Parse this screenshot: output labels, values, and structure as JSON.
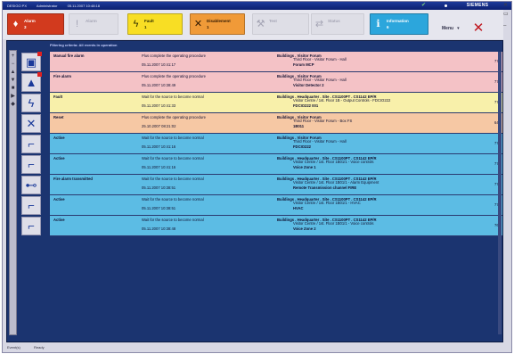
{
  "titlebar": {
    "app_name": "DESIGO PX",
    "user": "Administrator",
    "datetime": "05.11.2007 10:48:18",
    "brand": "SIEMENS",
    "check_icon": "check-icon",
    "dot_icon": "dot-icon"
  },
  "summary": {
    "buttons": [
      {
        "label": "Alarm",
        "count": "3",
        "icon": "alarm-bell-icon",
        "color": "#d23a1e"
      },
      {
        "label": "Alarm",
        "count": "",
        "icon": "alarm-grey-icon",
        "color": "#dedee6"
      },
      {
        "label": "Fault",
        "count": "1",
        "icon": "fault-lightning-icon",
        "color": "#f8de24"
      },
      {
        "label": "Disablement",
        "count": "1",
        "icon": "disablement-cross-icon",
        "color": "#f09a38"
      },
      {
        "label": "Test",
        "count": "",
        "icon": "test-icon",
        "color": "#dedee6"
      },
      {
        "label": "Status",
        "count": "",
        "icon": "status-icon",
        "color": "#dedee6"
      },
      {
        "label": "Information",
        "count": "6",
        "icon": "information-icon",
        "color": "#2ca6dc"
      }
    ],
    "menu_label": "Menu",
    "menu_chevron": "▾",
    "mute_icon": "✕"
  },
  "filter_text": "Filtering criteria: All events in operation",
  "left_tools": [
    "+",
    "−",
    "▲",
    "▼",
    "■",
    "▶",
    "◆"
  ],
  "rows": [
    {
      "color": "pink",
      "icon": "▣",
      "event": "Manual fire alarm",
      "hint": "Plus complete the operating procedure",
      "datetime": "05.11.2007  10:41:17",
      "location1": "Buildings . Visitor Forum",
      "location2": "Third Floor - Visitor Forum - Hall",
      "location3": "Forum MCP",
      "number": "776"
    },
    {
      "color": "pink",
      "icon": "▲",
      "event": "Fire alarm",
      "hint": "Plus complete the operating procedure",
      "datetime": "05.11.2007  10:38:49",
      "location1": "Buildings . Visitor Forum",
      "location2": "Third Floor - Visitor Forum - Hall",
      "location3": "Visitor Detector 2",
      "number": "772"
    },
    {
      "color": "yellow",
      "icon": "ϟ",
      "event": "Fault",
      "hint": "Wait for the source to become normal",
      "datetime": "05.11.2007  10:41:33",
      "location1": "Buildings . Headquarter . Site . CS1100PT . CS1142 EP/R",
      "location2": "Visitor Centre / 1st. Floor 1B - Output Controls - FDCIO222",
      "location3": "FDCIO222 001",
      "number": "774"
    },
    {
      "color": "peach",
      "icon": "✕",
      "event": "Reset",
      "hint": "Plus complete the operating procedure",
      "datetime": "25.10.2007  08:21:02",
      "location1": "Buildings . Visitor Forum",
      "location2": "Third Floor - Visitor Forum - Box FS",
      "location3": "1B011",
      "number": "649"
    },
    {
      "color": "cyan",
      "icon": "⌐",
      "event": "Active",
      "hint": "Wait for the source to become normal",
      "datetime": "05.11.2007  10:41:16",
      "location1": "Buildings . Visitor Forum",
      "location2": "Third Floor - Visitor Forum - Hall",
      "location3": "FDCIO222",
      "number": "777"
    },
    {
      "color": "cyan",
      "icon": "⌐",
      "event": "Active",
      "hint": "Wait for the source to become normal",
      "datetime": "05.11.2007  10:41:16",
      "location1": "Buildings . Headquarter . Site . CS1100PT . CS1142 EP/R",
      "location2": "Visitor Centre / 1st. Floor 1B01/1 - Voice controls",
      "location3": "Voice Zone 1",
      "number": "778"
    },
    {
      "color": "cyan",
      "icon": "⊷",
      "event": "Fire alarm transmitted",
      "hint": "Wait for the source to become normal",
      "datetime": "05.11.2007  10:38:51",
      "location1": "Buildings . Headquarter . Site . CS1100PT . CS1142 EP/R",
      "location2": "Visitor Centre / 1st. Floor 1B01/1 - Alarm Equipment",
      "location3": "Remote Transmission channel FIRE",
      "number": "775"
    },
    {
      "color": "cyan",
      "icon": "⌐",
      "event": "Active",
      "hint": "Wait for the source to become normal",
      "datetime": "05.11.2007  10:38:51",
      "location1": "Buildings . Headquarter . Site . CS1100PT . CS1142 EP/R",
      "location2": "Visitor Centre / 1st. Floor 1B01/1 - HVAC",
      "location3": "HVAC",
      "number": "773"
    },
    {
      "color": "cyan",
      "icon": "⌐",
      "event": "Active",
      "hint": "Wait for the source to become normal",
      "datetime": "05.11.2007  10:38:48",
      "location1": "Buildings . Headquarter . Site . CS1100PT . CS1142 EP/R",
      "location2": "Visitor Centre / 1st. Floor 1B01/1 - Voice controls",
      "location3": "Voice Zone 2",
      "number": "769"
    }
  ],
  "status": {
    "left": "Event(s)",
    "right": "Ready"
  }
}
